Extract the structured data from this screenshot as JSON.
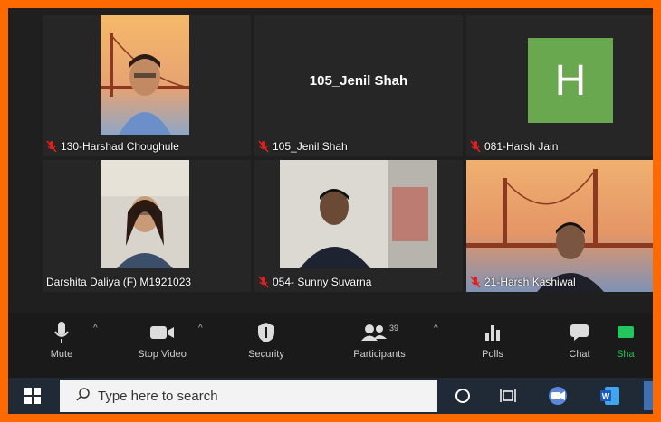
{
  "participants": [
    {
      "name": "130-Harshad Choughule",
      "muted": true,
      "video": "photo"
    },
    {
      "name": "105_Jenil Shah",
      "muted": true,
      "video": "off",
      "display_name": "105_Jenil Shah"
    },
    {
      "name": "081-Harsh Jain",
      "muted": true,
      "video": "avatar",
      "avatar_letter": "H"
    },
    {
      "name": "Darshita Daliya (F) M1921023",
      "muted": false,
      "video": "photo"
    },
    {
      "name": "054- Sunny Suvarna",
      "muted": true,
      "video": "photo"
    },
    {
      "name": "21-Harsh Kashiwal",
      "muted": true,
      "video": "photo"
    }
  ],
  "toolbar": {
    "mute_label": "Mute",
    "stop_video_label": "Stop Video",
    "security_label": "Security",
    "participants_label": "Participants",
    "participants_count": "39",
    "polls_label": "Polls",
    "chat_label": "Chat",
    "share_label": "Sha"
  },
  "taskbar": {
    "search_placeholder": "Type here to search"
  },
  "colors": {
    "frame_border": "#ff6a00",
    "avatar_bg": "#6aa84f",
    "muted_mic": "#e02020",
    "share_green": "#22c55e"
  }
}
